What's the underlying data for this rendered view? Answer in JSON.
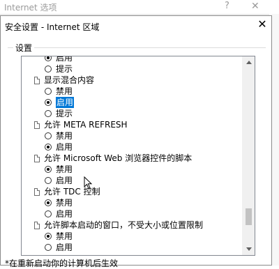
{
  "background_window": {
    "title": "Internet 选项",
    "help_glyph": "?",
    "close_glyph": "✕"
  },
  "dialog": {
    "title": "安全设置 - Internet 区域",
    "close_glyph": "✕",
    "group_label": "设置",
    "footnote": "*在重新启动你的计算机后生效",
    "accent_color": "#0078d7"
  },
  "settings_list": {
    "rows": [
      {
        "kind": "option",
        "label": "启用",
        "checked": true
      },
      {
        "kind": "option",
        "label": "提示",
        "checked": false
      },
      {
        "kind": "setting",
        "label": "显示混合内容"
      },
      {
        "kind": "option",
        "label": "禁用",
        "checked": false
      },
      {
        "kind": "option",
        "label": "启用",
        "checked": true,
        "selected": true
      },
      {
        "kind": "option",
        "label": "提示",
        "checked": false
      },
      {
        "kind": "setting",
        "label": "允许 META REFRESH"
      },
      {
        "kind": "option",
        "label": "禁用",
        "checked": false
      },
      {
        "kind": "option",
        "label": "启用",
        "checked": true
      },
      {
        "kind": "setting",
        "label": "允许 Microsoft Web 浏览器控件的脚本"
      },
      {
        "kind": "option",
        "label": "禁用",
        "checked": true
      },
      {
        "kind": "option",
        "label": "启用",
        "checked": false
      },
      {
        "kind": "setting",
        "label": "允许 TDC 控制"
      },
      {
        "kind": "option",
        "label": "禁用",
        "checked": true
      },
      {
        "kind": "option",
        "label": "启用",
        "checked": false
      },
      {
        "kind": "setting",
        "label": "允许脚本启动的窗口，不受大小或位置限制"
      },
      {
        "kind": "option",
        "label": "禁用",
        "checked": true
      },
      {
        "kind": "option",
        "label": "启用",
        "checked": false
      }
    ]
  }
}
